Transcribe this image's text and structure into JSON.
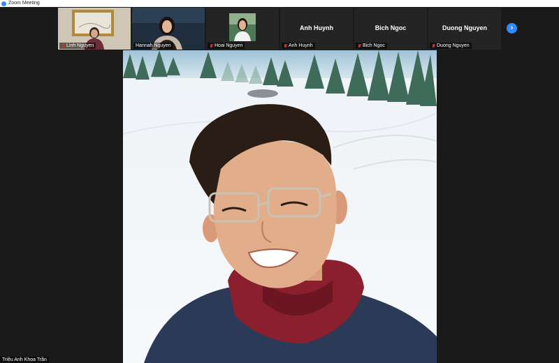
{
  "window": {
    "title": "Zoom Meeting"
  },
  "gallery": {
    "tiles": [
      {
        "name": "Linh Nguyen",
        "video": true,
        "muted": true
      },
      {
        "name": "Hannah Nguyen",
        "video": true,
        "muted": false
      },
      {
        "name": "Hoai Nguyen",
        "video": true,
        "muted": true
      },
      {
        "name": "Anh Huynh",
        "display_name": "Anh Huynh",
        "video": false,
        "muted": true
      },
      {
        "name": "Bich Ngoc",
        "display_name": "Bich Ngoc",
        "video": false,
        "muted": true
      },
      {
        "name": "Duong Nguyen",
        "display_name": "Duong Nguyen",
        "video": false,
        "muted": true
      }
    ],
    "next_icon": "chevron-right-icon"
  },
  "active_speaker": {
    "name": "Triệu Anh Khoa Trần"
  },
  "colors": {
    "accent": "#2d8cff",
    "muted": "#e02828",
    "background": "#1a1a1a"
  }
}
